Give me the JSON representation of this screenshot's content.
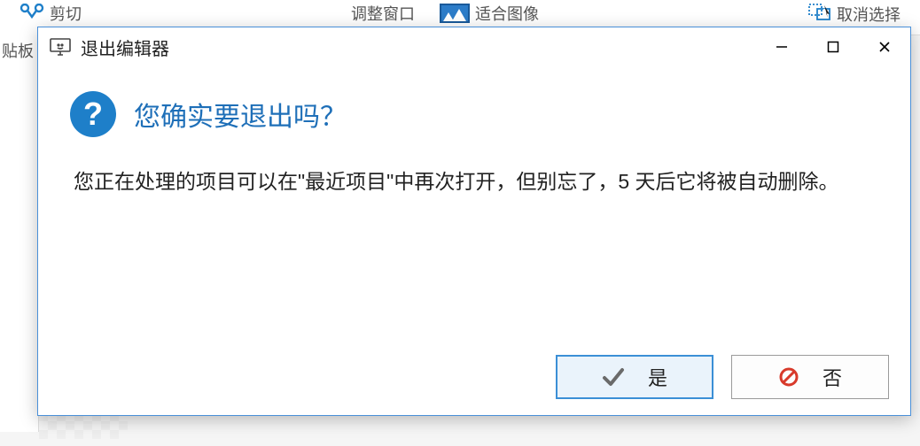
{
  "background": {
    "ribbon": {
      "cut_label": "剪切",
      "adjust_window_label": "调整窗口",
      "fit_image_label": "适合图像",
      "deselect_label": "取消选择"
    },
    "side_label": "贴板"
  },
  "dialog": {
    "title": "退出编辑器",
    "heading": "您确实要退出吗？",
    "body": "您正在处理的项目可以在\"最近项目\"中再次打开，但别忘了，5 天后它将被自动删除。",
    "yes_label": "是",
    "no_label": "否"
  },
  "icons": {
    "question_mark": "?",
    "checkmark": "✓"
  }
}
